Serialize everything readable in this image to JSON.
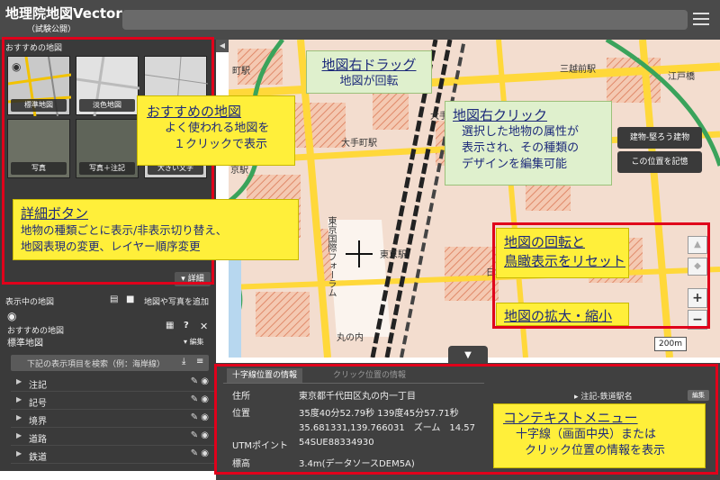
{
  "header": {
    "title": "地理院地図Vector",
    "subtitle": "（試験公開）"
  },
  "sidebar": {
    "recommended_heading": "おすすめの地図",
    "thumbnails": [
      "標準地図",
      "淡色地図",
      "写真",
      "写真＋注記",
      "大きい文字"
    ],
    "detail_button": "詳細",
    "displayed_heading": "表示中の地図",
    "add_map_link": "地図や写真を追加",
    "current_group": "おすすめの地図",
    "current_map": "標準地図",
    "edit_label": "編集",
    "search_placeholder": "下記の表示項目を検索（例：海岸線）",
    "layers": [
      "注記",
      "記号",
      "境界",
      "道路",
      "鉄道"
    ]
  },
  "map": {
    "labels": [
      "大手町駅",
      "三越前駅",
      "東京駅",
      "大手町",
      "日本橋",
      "丸の内",
      "町駅",
      "京駅",
      "江戸橋"
    ],
    "vertical_labels": [
      "東京国際フォーラム"
    ],
    "scale": "200m",
    "popup_buttons": [
      "建物-堅ろう建物",
      "この位置を記憶"
    ],
    "zoom_in": "+",
    "zoom_out": "−"
  },
  "info_panel": {
    "tab_crosshair": "十字線位置の情報",
    "tab_click": "クリック位置の情報",
    "rows": [
      {
        "key": "住所",
        "value": "東京都千代田区丸の内一丁目"
      },
      {
        "key": "位置",
        "value": "35度40分52.79秒 139度45分57.71秒"
      },
      {
        "key": "",
        "value": "35.681331,139.766031　ズーム　14.57"
      },
      {
        "key": "UTMポイント",
        "value": "54SUE88334930"
      },
      {
        "key": "標高",
        "value": "3.4m(データソースDEM5A)"
      }
    ],
    "side_item": "▸ 注記-鉄道駅名",
    "side_edit": "編集"
  },
  "annotations": {
    "recommended": {
      "title": "おすすめの地図",
      "lines": [
        "よく使われる地図を",
        "１クリックで表示"
      ]
    },
    "detail": {
      "title": "詳細ボタン",
      "lines": [
        "地物の種類ごとに表示/非表示切り替え、",
        "地図表現の変更、レイヤー順序変更"
      ]
    },
    "drag": {
      "title": "地図右ドラッグ",
      "lines": [
        "地図が回転"
      ]
    },
    "rightclick": {
      "title": "地図右クリック",
      "lines": [
        "選択した地物の属性が",
        "表示され、その種類の",
        "デザインを編集可能"
      ]
    },
    "reset": {
      "title": "地図の回転と",
      "lines": [
        "鳥瞰表示をリセット"
      ]
    },
    "zoom": {
      "title": "地図の拡大・縮小",
      "lines": []
    },
    "context": {
      "title": "コンテキストメニュー",
      "lines": [
        "十字線（画面中央）または",
        "クリック位置の情報を表示"
      ]
    }
  },
  "colors": {
    "annotation_yellow": "#ffef3a",
    "annotation_green": "#dff0cd",
    "annotation_text": "#1d2a7a",
    "highlight_red": "#e0001b",
    "road_yellow": "#ffd83a",
    "panel_dark": "#3a3a3a"
  }
}
